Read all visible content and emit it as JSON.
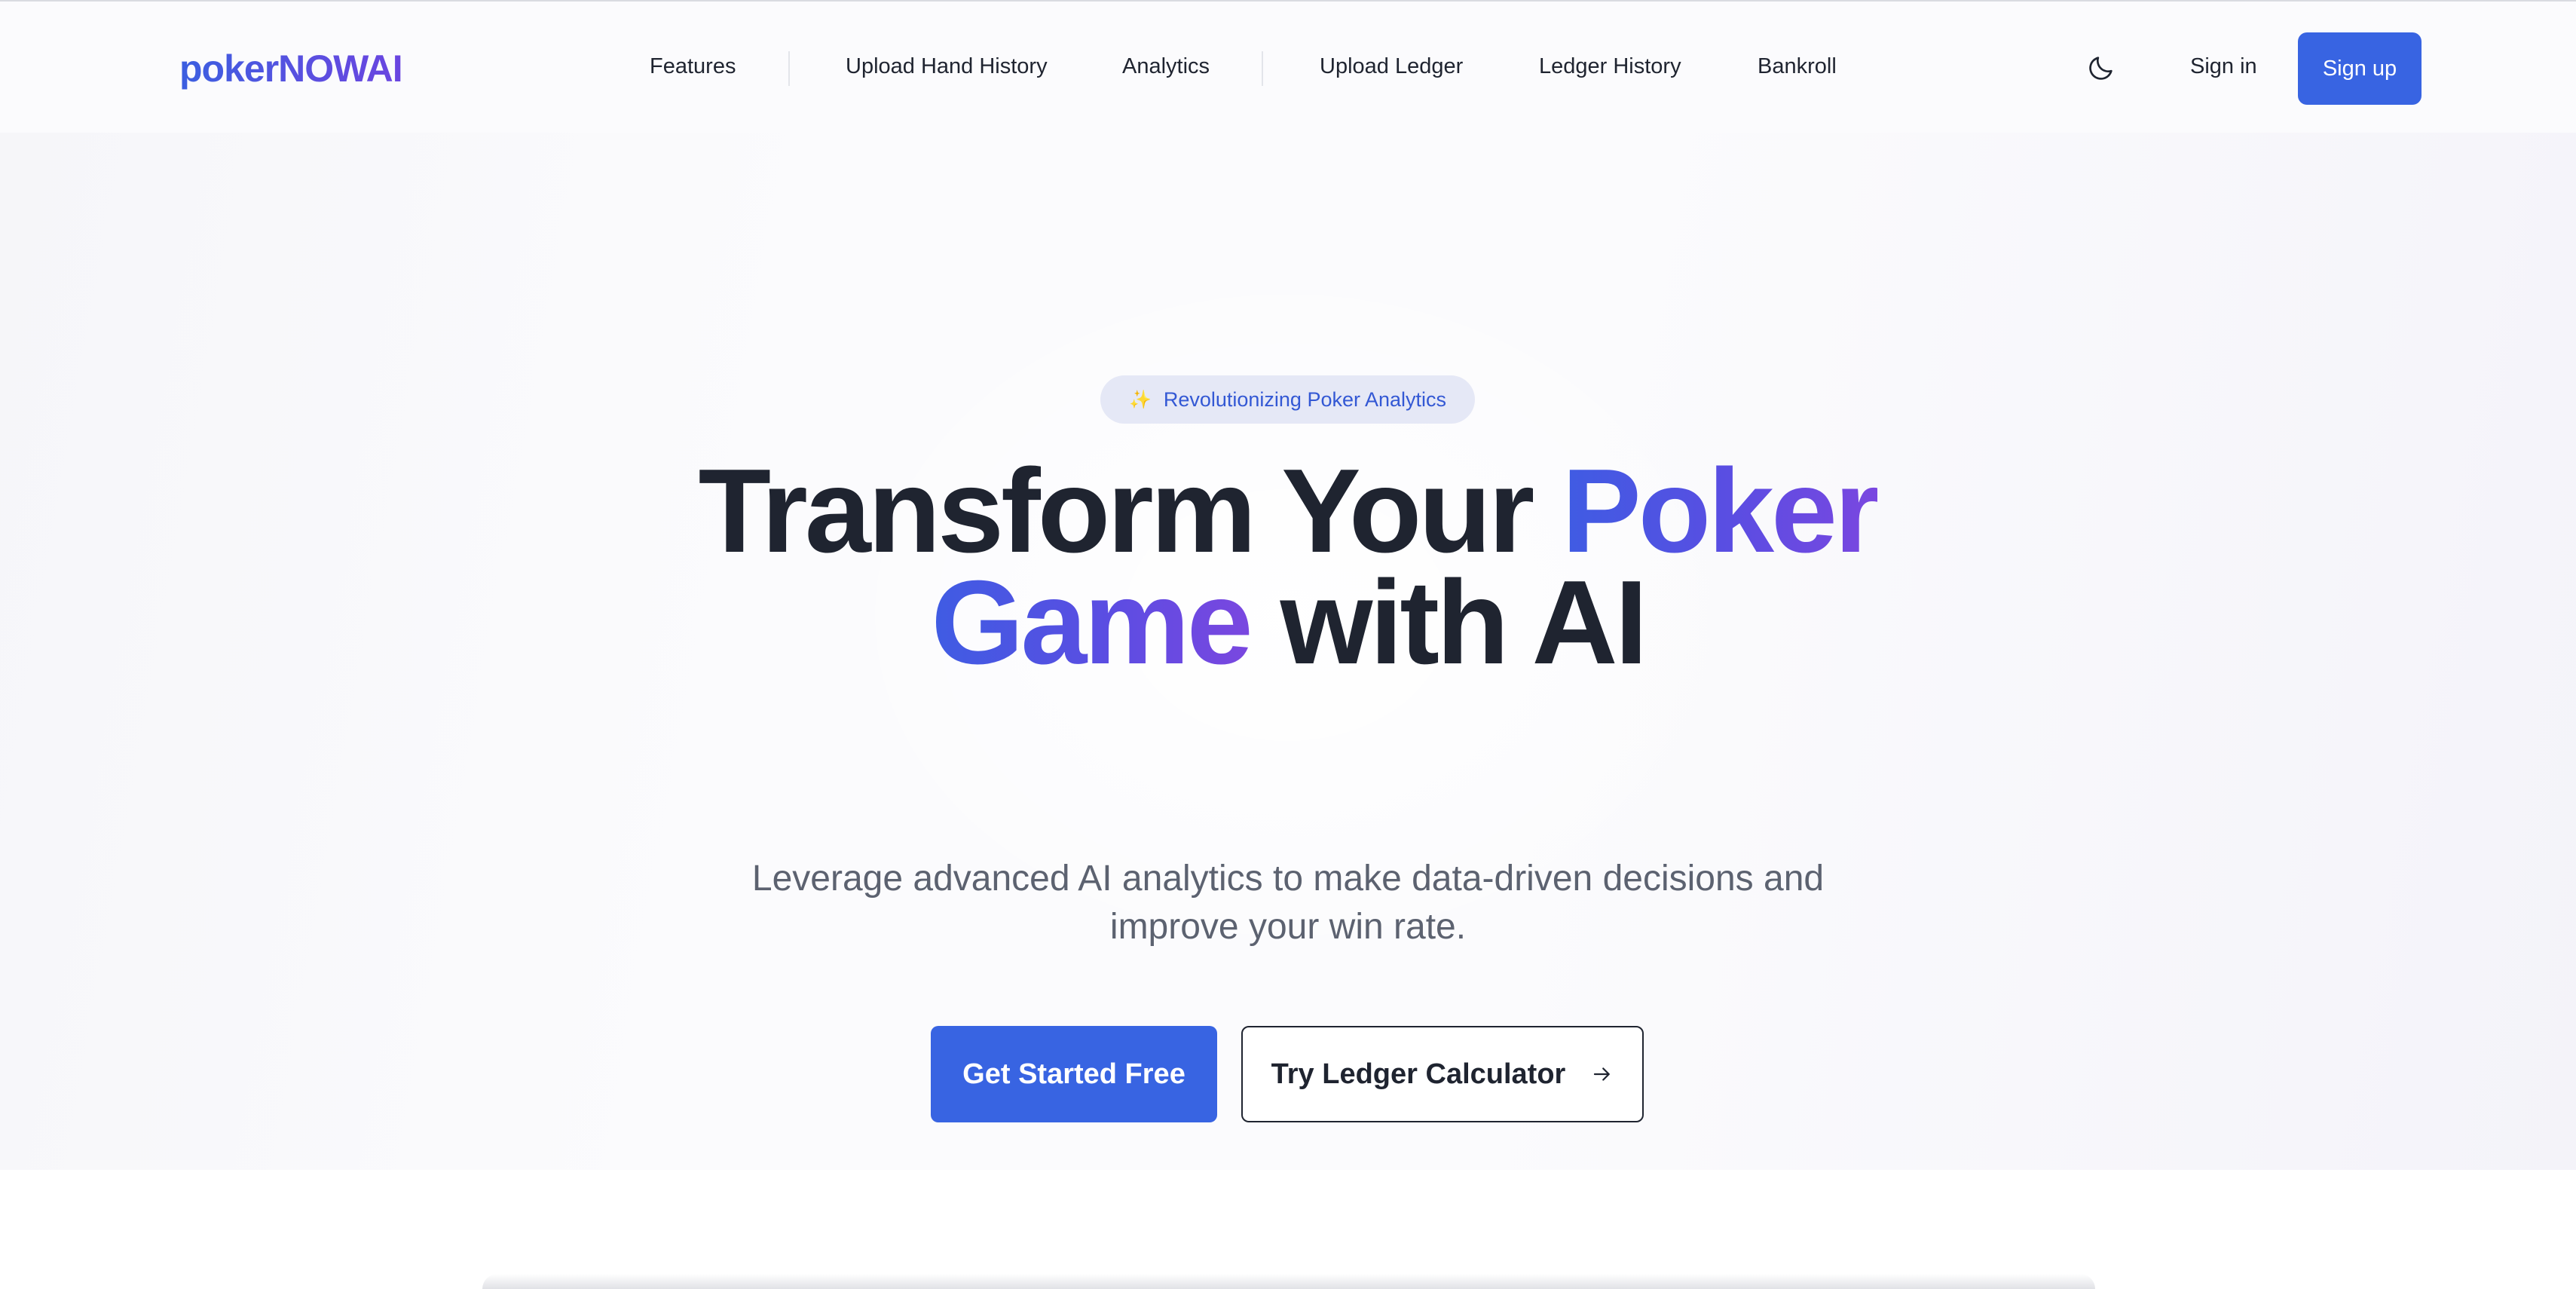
{
  "brand": {
    "logo_text": "pokerNOWAI"
  },
  "nav": {
    "links": [
      "Features",
      "Upload Hand History",
      "Analytics",
      "Upload Ledger",
      "Ledger History",
      "Bankroll"
    ],
    "theme_icon": "moon-icon",
    "signin_label": "Sign in",
    "signup_label": "Sign up"
  },
  "hero": {
    "badge_icon": "sparkles-icon",
    "badge_text": "Revolutionizing Poker Analytics",
    "headline_part1": "Transform Your ",
    "headline_highlight1": "Poker",
    "headline_highlight2": "Game",
    "headline_part2": " with AI",
    "subtext_line1": "Leverage advanced AI analytics to make data-driven decisions and",
    "subtext_line2": "improve your win rate.",
    "primary_cta": "Get Started Free",
    "secondary_cta": "Try Ledger Calculator",
    "secondary_icon": "arrow-right-icon"
  },
  "colors": {
    "accent": "#3864e2",
    "gradient_start": "#3f5ce3",
    "gradient_end": "#7a47e0",
    "text_dark": "#1f2430",
    "text_muted": "#5c6270"
  }
}
